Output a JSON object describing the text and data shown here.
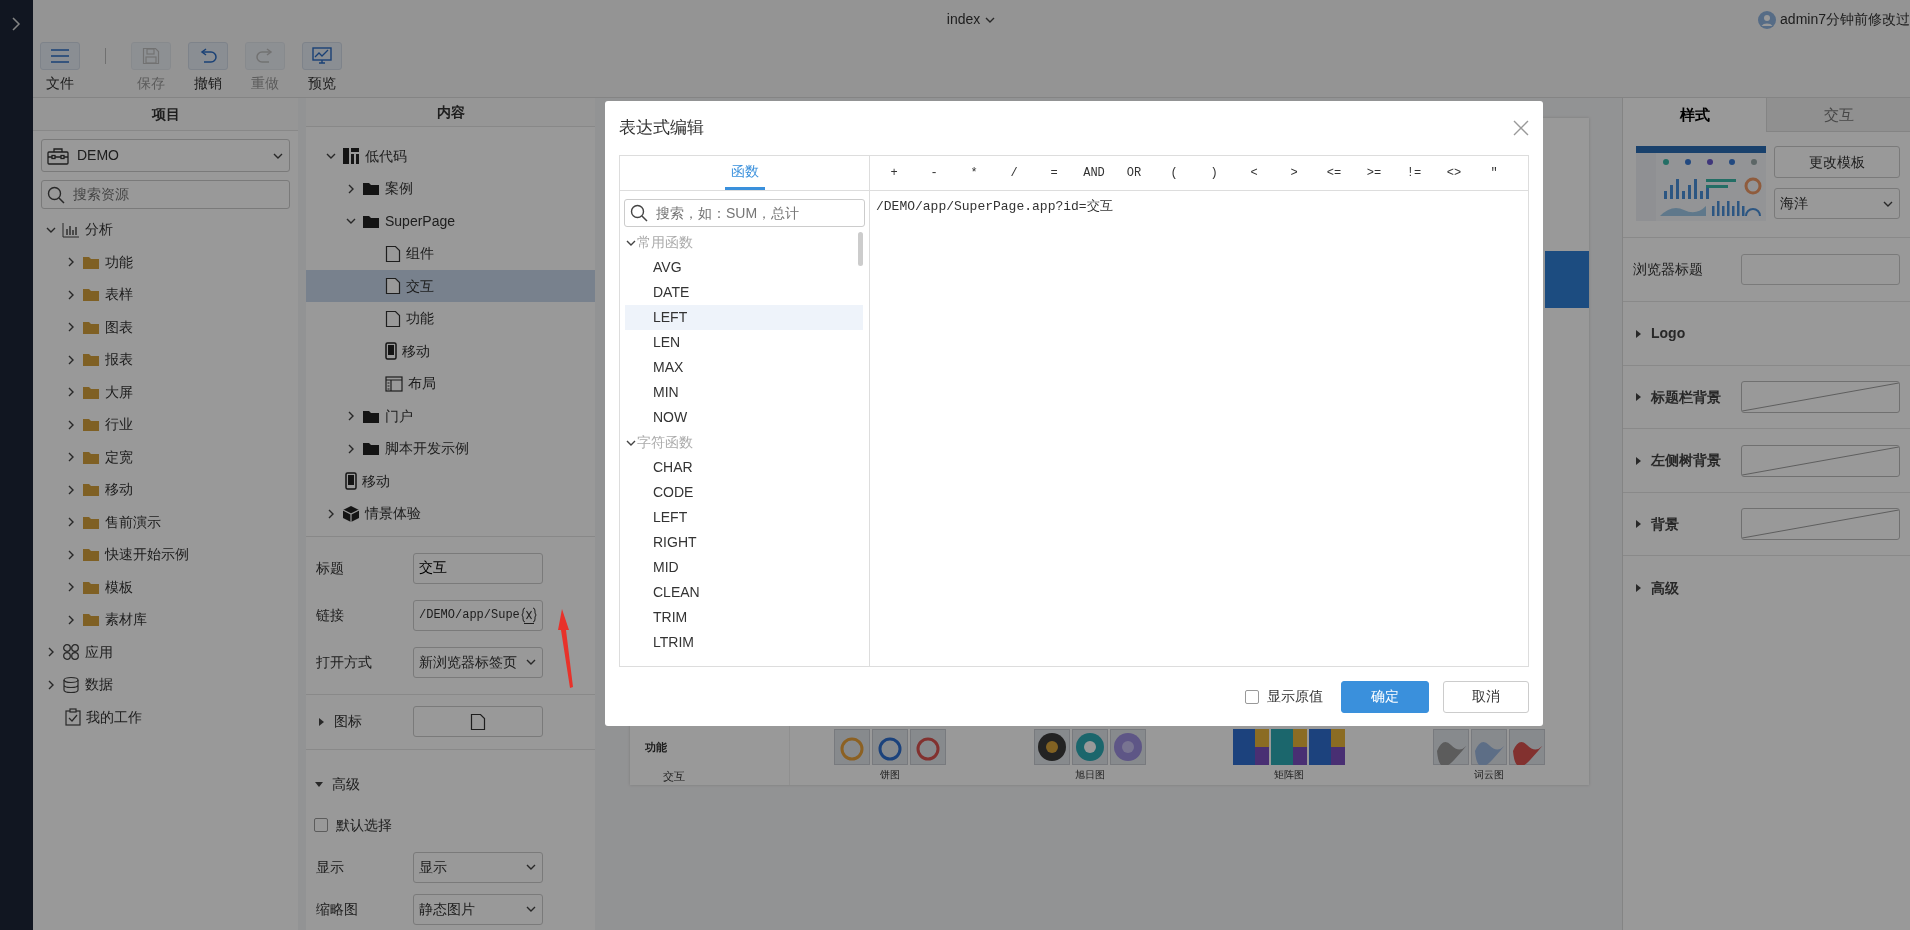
{
  "header": {
    "title": "index",
    "user": "admin7分钟前修改过"
  },
  "toolbar": [
    {
      "label": "文件",
      "kind": "menu",
      "disabled": false
    },
    {
      "label": "保存",
      "kind": "save",
      "disabled": true
    },
    {
      "label": "撤销",
      "kind": "undo",
      "disabled": false
    },
    {
      "label": "重做",
      "kind": "redo",
      "disabled": true
    },
    {
      "label": "预览",
      "kind": "preview",
      "disabled": false
    }
  ],
  "project_panel": {
    "title": "项目",
    "project": "DEMO",
    "search": {
      "placeholder": "搜索资源"
    },
    "tree": [
      {
        "label": "分析",
        "kind": "chart",
        "expanded": true,
        "children": [
          {
            "label": "功能",
            "kind": "folder",
            "expanded": false
          },
          {
            "label": "表样",
            "kind": "folder",
            "expanded": false
          },
          {
            "label": "图表",
            "kind": "folder",
            "expanded": false
          },
          {
            "label": "报表",
            "kind": "folder",
            "expanded": false
          },
          {
            "label": "大屏",
            "kind": "folder",
            "expanded": false
          },
          {
            "label": "行业",
            "kind": "folder",
            "expanded": false
          },
          {
            "label": "定宽",
            "kind": "folder",
            "expanded": false
          },
          {
            "label": "移动",
            "kind": "folder",
            "expanded": false
          },
          {
            "label": "售前演示",
            "kind": "folder",
            "expanded": false
          },
          {
            "label": "快速开始示例",
            "kind": "folder",
            "expanded": false
          },
          {
            "label": "模板",
            "kind": "folder",
            "expanded": false
          },
          {
            "label": "素材库",
            "kind": "folder",
            "expanded": false
          }
        ]
      },
      {
        "label": "应用",
        "kind": "apps",
        "expanded": false
      },
      {
        "label": "数据",
        "kind": "database",
        "expanded": false
      },
      {
        "label": "我的工作",
        "kind": "task"
      }
    ]
  },
  "content_panel": {
    "title": "内容",
    "tree": [
      {
        "label": "低代码",
        "kind": "grid",
        "expanded": true,
        "selected": false,
        "children": [
          {
            "label": "案例",
            "kind": "folder",
            "expanded": false,
            "selected": false
          },
          {
            "label": "SuperPage",
            "kind": "folder",
            "expanded": true,
            "selected": false,
            "children": [
              {
                "label": "组件",
                "kind": "file",
                "selected": false
              },
              {
                "label": "交互",
                "kind": "file",
                "selected": true
              },
              {
                "label": "功能",
                "kind": "file",
                "selected": false
              },
              {
                "label": "移动",
                "kind": "mobile",
                "selected": false
              },
              {
                "label": "布局",
                "kind": "layout",
                "selected": false
              }
            ]
          },
          {
            "label": "门户",
            "kind": "folder",
            "expanded": false,
            "selected": false
          },
          {
            "label": "脚本开发示例",
            "kind": "folder",
            "expanded": false,
            "selected": false
          }
        ]
      },
      {
        "label": "移动",
        "kind": "mobile",
        "selected": false
      },
      {
        "label": "情景体验",
        "kind": "cube",
        "expanded": false,
        "selected": false
      }
    ],
    "properties": [
      {
        "label": "标题",
        "kind": "text",
        "value": "交互"
      },
      {
        "label": "链接",
        "kind": "expression",
        "value": "/DEMO/app/Supe"
      },
      {
        "label": "打开方式",
        "kind": "select",
        "value": "新浏览器标签页"
      }
    ],
    "icon_section": {
      "label": "图标",
      "expanded": false
    },
    "advanced": {
      "label": "高级",
      "expanded": true,
      "default_select": {
        "label": "默认选择",
        "checked": false
      },
      "fields": [
        {
          "label": "显示",
          "value": "显示"
        },
        {
          "label": "缩略图",
          "value": "静态图片"
        }
      ]
    }
  },
  "canvas": {
    "row_labels": [
      "功能",
      "交互"
    ],
    "thumbnail_groups": [
      {
        "caption": "饼图",
        "kind": "ring"
      },
      {
        "caption": "旭日图",
        "kind": "sunburst"
      },
      {
        "caption": "矩阵图",
        "kind": "treemap"
      },
      {
        "caption": "词云图",
        "kind": "cloud"
      }
    ]
  },
  "style_panel": {
    "tabs": [
      {
        "label": "样式",
        "selected": true
      },
      {
        "label": "交互",
        "selected": false
      }
    ],
    "change_template": "更改模板",
    "theme": "海洋",
    "browser_title": {
      "label": "浏览器标题"
    },
    "sections": [
      {
        "label": "Logo",
        "swatch": false
      },
      {
        "label": "标题栏背景",
        "swatch": true
      },
      {
        "label": "左侧树背景",
        "swatch": true
      },
      {
        "label": "背景",
        "swatch": true
      },
      {
        "label": "高级",
        "swatch": false
      }
    ]
  },
  "dialog": {
    "title": "表达式编辑",
    "tabs": [
      {
        "label": "函数",
        "selected": true
      }
    ],
    "search": {
      "placeholder": "搜索，如：SUM，总计"
    },
    "groups": [
      {
        "label": "常用函数",
        "expanded": true,
        "items": [
          {
            "label": "AVG",
            "selected": false
          },
          {
            "label": "DATE",
            "selected": false
          },
          {
            "label": "LEFT",
            "selected": true
          },
          {
            "label": "LEN",
            "selected": false
          },
          {
            "label": "MAX",
            "selected": false
          },
          {
            "label": "MIN",
            "selected": false
          },
          {
            "label": "NOW",
            "selected": false
          }
        ]
      },
      {
        "label": "字符函数",
        "expanded": true,
        "items": [
          {
            "label": "CHAR",
            "selected": false
          },
          {
            "label": "CODE",
            "selected": false
          },
          {
            "label": "LEFT",
            "selected": false
          },
          {
            "label": "RIGHT",
            "selected": false
          },
          {
            "label": "MID",
            "selected": false
          },
          {
            "label": "CLEAN",
            "selected": false
          },
          {
            "label": "TRIM",
            "selected": false
          },
          {
            "label": "LTRIM",
            "selected": false
          }
        ]
      }
    ],
    "operators": [
      "+",
      "-",
      "*",
      "/",
      "=",
      "AND",
      "OR",
      "(",
      ")",
      "<",
      ">",
      "<=",
      ">=",
      "!=",
      "<>",
      "\""
    ],
    "expression": "/DEMO/app/SuperPage.app?id=交互",
    "show_raw": {
      "label": "显示原值",
      "checked": false
    },
    "buttons": [
      {
        "label": "确定",
        "kind": "primary"
      },
      {
        "label": "取消",
        "kind": "secondary"
      }
    ]
  }
}
